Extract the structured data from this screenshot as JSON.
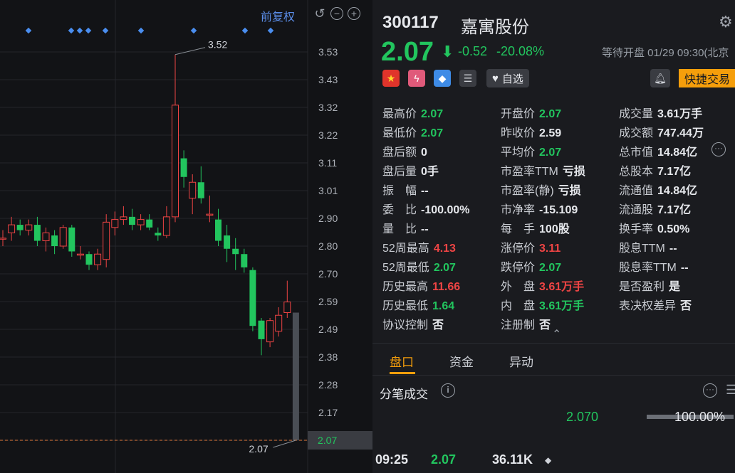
{
  "chart": {
    "fq_label": "前复权",
    "y_ticks": [
      "3.53",
      "3.43",
      "3.32",
      "3.22",
      "3.11",
      "3.01",
      "2.90",
      "2.80",
      "2.70",
      "2.59",
      "2.49",
      "2.38",
      "2.28",
      "2.17",
      "2.07"
    ],
    "current_price_tag": "2.07",
    "high_annotation": "3.52",
    "low_annotation": "2.07",
    "candles": [
      {
        "o": 2.83,
        "c": 2.83,
        "h": 2.86,
        "l": 2.8
      },
      {
        "o": 2.85,
        "c": 2.88,
        "h": 2.91,
        "l": 2.82
      },
      {
        "o": 2.88,
        "c": 2.86,
        "h": 2.9,
        "l": 2.84
      },
      {
        "o": 2.86,
        "c": 2.88,
        "h": 2.9,
        "l": 2.84
      },
      {
        "o": 2.88,
        "c": 2.82,
        "h": 2.91,
        "l": 2.8
      },
      {
        "o": 2.82,
        "c": 2.85,
        "h": 2.87,
        "l": 2.78
      },
      {
        "o": 2.84,
        "c": 2.8,
        "h": 2.86,
        "l": 2.77
      },
      {
        "o": 2.8,
        "c": 2.87,
        "h": 2.88,
        "l": 2.79
      },
      {
        "o": 2.87,
        "c": 2.78,
        "h": 2.88,
        "l": 2.76
      },
      {
        "o": 2.77,
        "c": 2.77,
        "h": 2.8,
        "l": 2.75
      },
      {
        "o": 2.77,
        "c": 2.73,
        "h": 2.78,
        "l": 2.71
      },
      {
        "o": 2.73,
        "c": 2.77,
        "h": 2.79,
        "l": 2.71
      },
      {
        "o": 2.75,
        "c": 2.89,
        "h": 2.92,
        "l": 2.72
      },
      {
        "o": 2.87,
        "c": 2.9,
        "h": 2.93,
        "l": 2.84
      },
      {
        "o": 2.9,
        "c": 2.91,
        "h": 2.95,
        "l": 2.88
      },
      {
        "o": 2.91,
        "c": 2.88,
        "h": 2.94,
        "l": 2.86
      },
      {
        "o": 2.88,
        "c": 2.9,
        "h": 2.92,
        "l": 2.86
      },
      {
        "o": 2.9,
        "c": 2.87,
        "h": 2.92,
        "l": 2.86
      },
      {
        "o": 2.85,
        "c": 2.84,
        "h": 2.87,
        "l": 2.82
      },
      {
        "o": 2.84,
        "c": 2.91,
        "h": 2.95,
        "l": 2.83
      },
      {
        "o": 2.91,
        "c": 3.33,
        "h": 3.52,
        "l": 2.89
      },
      {
        "o": 3.13,
        "c": 3.06,
        "h": 3.16,
        "l": 3.02
      },
      {
        "o": 2.98,
        "c": 3.04,
        "h": 3.07,
        "l": 2.92
      },
      {
        "o": 3.04,
        "c": 2.98,
        "h": 3.1,
        "l": 2.96
      },
      {
        "o": 2.92,
        "c": 2.92,
        "h": 2.99,
        "l": 2.89
      },
      {
        "o": 2.9,
        "c": 2.82,
        "h": 2.94,
        "l": 2.8
      },
      {
        "o": 2.84,
        "c": 2.79,
        "h": 2.88,
        "l": 2.74
      },
      {
        "o": 2.79,
        "c": 2.77,
        "h": 2.83,
        "l": 2.71
      },
      {
        "o": 2.77,
        "c": 2.72,
        "h": 2.79,
        "l": 2.7
      },
      {
        "o": 2.71,
        "c": 2.5,
        "h": 2.72,
        "l": 2.48
      },
      {
        "o": 2.52,
        "c": 2.45,
        "h": 2.53,
        "l": 2.39
      },
      {
        "o": 2.44,
        "c": 2.52,
        "h": 2.53,
        "l": 2.42
      },
      {
        "o": 2.48,
        "c": 2.54,
        "h": 2.57,
        "l": 2.46
      },
      {
        "o": 2.55,
        "c": 2.59,
        "h": 2.67,
        "l": 2.53
      },
      {
        "o": 2.55,
        "c": 2.07,
        "h": 2.55,
        "l": 2.07
      }
    ]
  },
  "header": {
    "code": "300117",
    "name": "嘉寓股份",
    "price": "2.07",
    "change": "-0.52",
    "change_pct": "-20.08%",
    "status": "等待开盘 01/29 09:30(北京",
    "watch_label": "自选",
    "quick_trade_label": "快捷交易"
  },
  "fields": {
    "col1": [
      {
        "label": "最高价",
        "value": "2.07",
        "color": "green"
      },
      {
        "label": "最低价",
        "value": "2.07",
        "color": "green"
      },
      {
        "label": "盘后额",
        "value": "0",
        "color": "white"
      },
      {
        "label": "盘后量",
        "value": "0手",
        "color": "white"
      },
      {
        "label": "振　幅",
        "value": "--",
        "color": "white"
      },
      {
        "label": "委　比",
        "value": "-100.00%",
        "color": "white"
      },
      {
        "label": "量　比",
        "value": "--",
        "color": "white"
      },
      {
        "label": "52周最高",
        "value": "4.13",
        "color": "red"
      },
      {
        "label": "52周最低",
        "value": "2.07",
        "color": "green"
      },
      {
        "label": "历史最高",
        "value": "11.66",
        "color": "red"
      },
      {
        "label": "历史最低",
        "value": "1.64",
        "color": "green"
      },
      {
        "label": "协议控制",
        "value": "否",
        "color": "white"
      }
    ],
    "col2": [
      {
        "label": "开盘价",
        "value": "2.07",
        "color": "green"
      },
      {
        "label": "昨收价",
        "value": "2.59",
        "color": "white"
      },
      {
        "label": "平均价",
        "value": "2.07",
        "color": "green"
      },
      {
        "label": "市盈率TTM",
        "value": "亏损",
        "color": "white"
      },
      {
        "label": "市盈率(静)",
        "value": "亏损",
        "color": "white"
      },
      {
        "label": "市净率",
        "value": "-15.109",
        "color": "white"
      },
      {
        "label": "每　手",
        "value": "100股",
        "color": "white"
      },
      {
        "label": "涨停价",
        "value": "3.11",
        "color": "red"
      },
      {
        "label": "跌停价",
        "value": "2.07",
        "color": "green"
      },
      {
        "label": "外　盘",
        "value": "3.61万手",
        "color": "red"
      },
      {
        "label": "内　盘",
        "value": "3.61万手",
        "color": "green"
      },
      {
        "label": "注册制",
        "value": "否",
        "color": "white"
      }
    ],
    "col3": [
      {
        "label": "成交量",
        "value": "3.61万手",
        "color": "white"
      },
      {
        "label": "成交额",
        "value": "747.44万",
        "color": "white"
      },
      {
        "label": "总市值",
        "value": "14.84亿",
        "color": "white"
      },
      {
        "label": "总股本",
        "value": "7.17亿",
        "color": "white"
      },
      {
        "label": "流通值",
        "value": "14.84亿",
        "color": "white"
      },
      {
        "label": "流通股",
        "value": "7.17亿",
        "color": "white"
      },
      {
        "label": "换手率",
        "value": "0.50%",
        "color": "white"
      },
      {
        "label": "股息TTM",
        "value": "--",
        "color": "white"
      },
      {
        "label": "股息率TTM",
        "value": "--",
        "color": "white"
      },
      {
        "label": "是否盈利",
        "value": "是",
        "color": "white"
      },
      {
        "label": "表决权差异",
        "value": "否",
        "color": "white"
      }
    ]
  },
  "tabs": [
    "盘口",
    "资金",
    "异动"
  ],
  "ticks": {
    "title": "分笔成交",
    "buy_price": "2.070",
    "buy_pct": "100.00%",
    "buy_fraction": 1.0,
    "rows": [
      {
        "time": "09:25",
        "price": "2.07",
        "volume": "36.11K"
      }
    ]
  },
  "colors": {
    "up": "#ef4444",
    "down": "#22c55e",
    "accent": "#f59e0b",
    "link": "#5b8de8"
  }
}
